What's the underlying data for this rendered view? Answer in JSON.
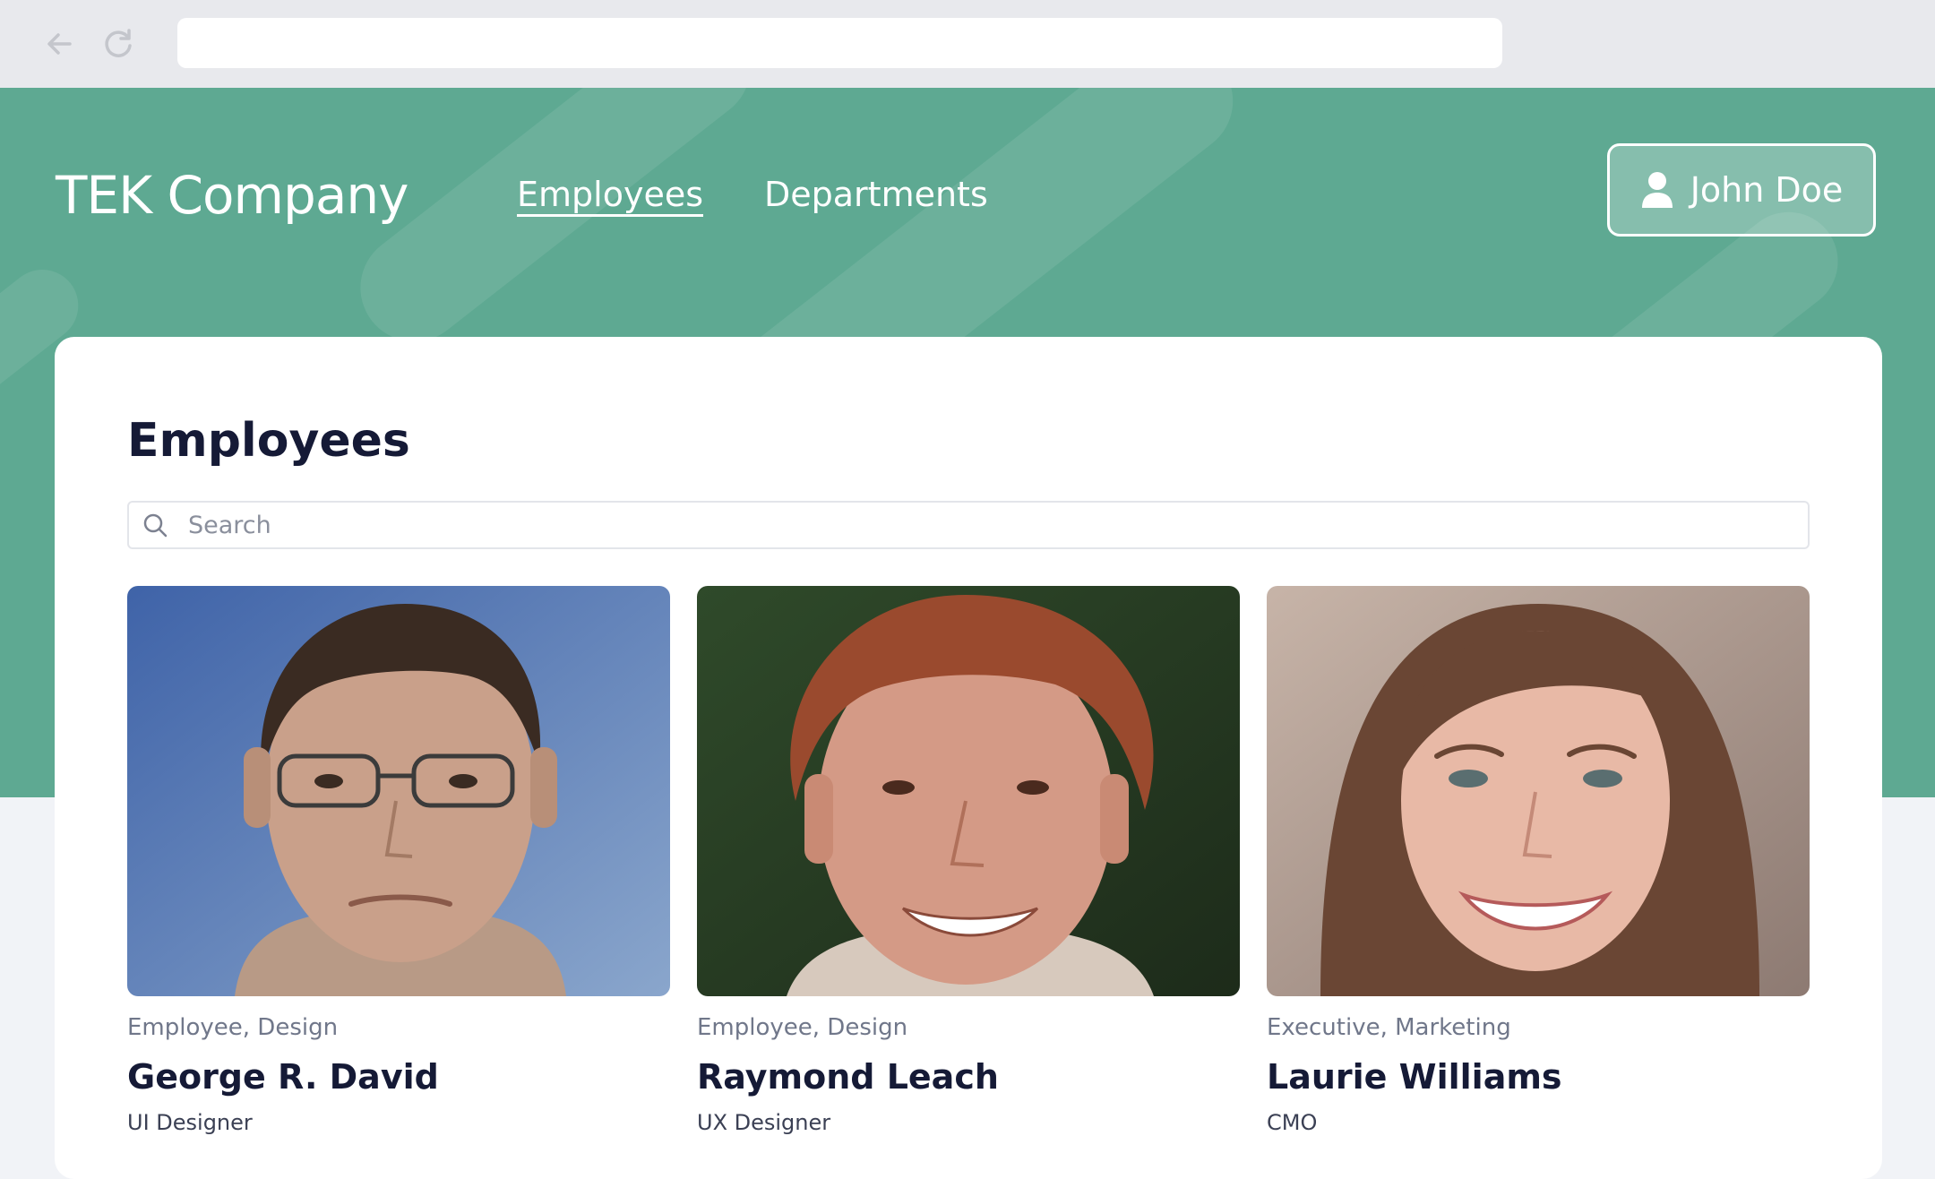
{
  "header": {
    "brand": "TEK Company",
    "nav": [
      {
        "label": "Employees",
        "active": true
      },
      {
        "label": "Departments",
        "active": false
      }
    ],
    "user": {
      "name": "John Doe"
    }
  },
  "main": {
    "title": "Employees",
    "search": {
      "placeholder": "Search",
      "value": ""
    },
    "employees": [
      {
        "meta": "Employee, Design",
        "name": "George R. David",
        "role": "UI Designer"
      },
      {
        "meta": "Employee, Design",
        "name": "Raymond Leach",
        "role": "UX Designer"
      },
      {
        "meta": "Executive, Marketing",
        "name": "Laurie Williams",
        "role": "CMO"
      }
    ]
  },
  "colors": {
    "accent": "#5ea992",
    "heading": "#151a36",
    "muted": "#70778a"
  },
  "icons": [
    "back-arrow-icon",
    "reload-icon",
    "user-icon",
    "search-icon"
  ]
}
